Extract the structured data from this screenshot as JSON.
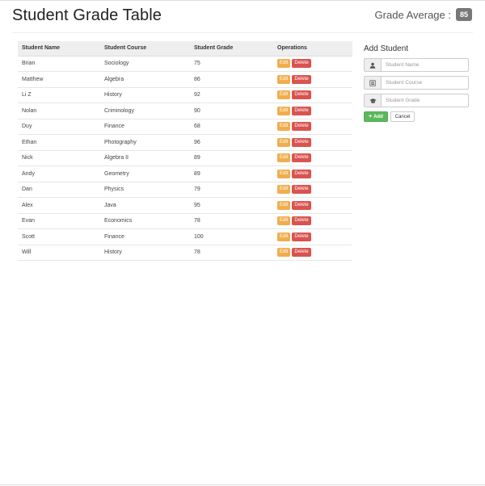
{
  "header": {
    "title": "Student Grade Table",
    "average_label": "Grade Average :",
    "average_value": "85"
  },
  "table": {
    "columns": [
      "Student Name",
      "Student Course",
      "Student Grade",
      "Operations"
    ],
    "edit_label": "Edit",
    "delete_label": "Delete",
    "rows": [
      {
        "name": "Brian",
        "course": "Sociology",
        "grade": "75"
      },
      {
        "name": "Matthew",
        "course": "Algebra",
        "grade": "86"
      },
      {
        "name": "Li Z",
        "course": "History",
        "grade": "92"
      },
      {
        "name": "Nolan",
        "course": "Criminology",
        "grade": "90"
      },
      {
        "name": "Duy",
        "course": "Finance",
        "grade": "68"
      },
      {
        "name": "Ethan",
        "course": "Photography",
        "grade": "96"
      },
      {
        "name": "Nick",
        "course": "Algebra II",
        "grade": "89"
      },
      {
        "name": "Andy",
        "course": "Geometry",
        "grade": "89"
      },
      {
        "name": "Dan",
        "course": "Physics",
        "grade": "79"
      },
      {
        "name": "Alex",
        "course": "Java",
        "grade": "95"
      },
      {
        "name": "Evan",
        "course": "Economics",
        "grade": "78"
      },
      {
        "name": "Scott",
        "course": "Finance",
        "grade": "100"
      },
      {
        "name": "Will",
        "course": "History",
        "grade": "78"
      }
    ]
  },
  "form": {
    "title": "Add Student",
    "name_placeholder": "Student Name",
    "course_placeholder": "Student Course",
    "grade_placeholder": "Student Grade",
    "name_icon": "user-icon",
    "course_icon": "list-icon",
    "grade_icon": "graduation-cap-icon",
    "add_label": "Add",
    "cancel_label": "Cancel"
  },
  "colors": {
    "edit": "#f0ad4e",
    "delete": "#d9534f",
    "add": "#5cb85c",
    "badge": "#777777"
  }
}
